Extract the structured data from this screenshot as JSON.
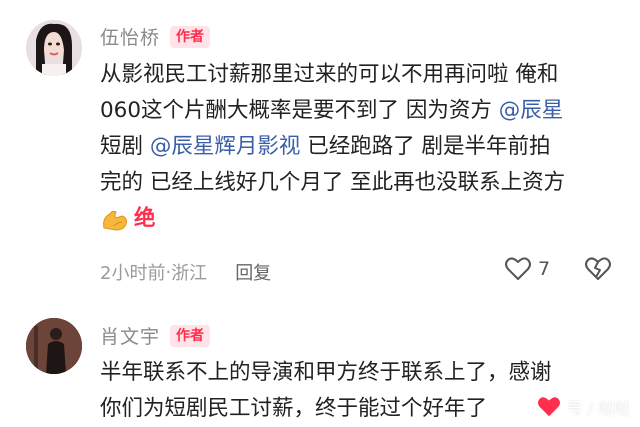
{
  "comments": [
    {
      "username": "伍怡桥",
      "badge": "作者",
      "lines": [
        "从影视民工讨薪那里过来的可以不用再问啦 俺和",
        "060这个片酬大概率是要不到了 因为资方 ",
        "短剧 ",
        "完的 已经上线好几个月了 至此再也没联系上资方"
      ],
      "mention_1": "@辰星",
      "mention_2": "@辰星辉月影视",
      "line3_tail": " 已经跑路了 剧是半年前拍",
      "last_word": "绝",
      "meta_time": "2小时前",
      "meta_sep": " · ",
      "meta_location": "浙江",
      "reply_label": "回复",
      "like_count": "7",
      "like_icon": "heart-outline-icon",
      "dislike_icon": "broken-heart-icon"
    },
    {
      "username": "肖文宇",
      "badge": "作者",
      "lines": [
        "半年联系不上的导演和甲方终于联系上了，感谢",
        "你们为短剧民工讨薪，终于能过个好年了"
      ]
    }
  ],
  "watermark": "号 / 哒哒"
}
